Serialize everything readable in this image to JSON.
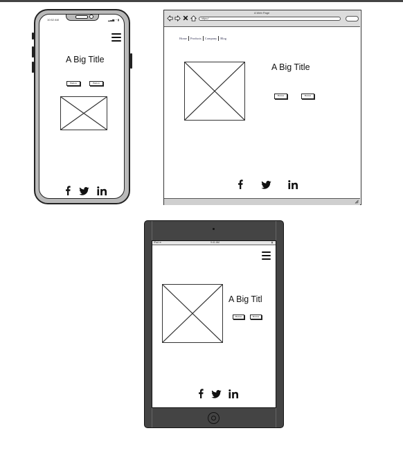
{
  "phone": {
    "status_time": "10:52 AM",
    "status_icons": "▂▃▅ ◔ ▮",
    "title": "A Big Title",
    "buttons": [
      "Button",
      "Button"
    ],
    "social": [
      "facebook-icon",
      "twitter-icon",
      "linkedin-icon"
    ]
  },
  "browser": {
    "window_title": "A Web Page",
    "url": "https://",
    "nav": [
      "Home",
      "Products",
      "Company",
      "Blog"
    ],
    "title": "A Big Title",
    "buttons": [
      "Button",
      "Button"
    ],
    "social": [
      "facebook-icon",
      "twitter-icon",
      "linkedin-icon"
    ]
  },
  "tablet": {
    "status_left": "iPad ≋",
    "status_time": "9:41 AM",
    "status_right": "▮",
    "title": "A Big Titl",
    "buttons": [
      "Button",
      "Button"
    ],
    "social": [
      "facebook-icon",
      "twitter-icon",
      "linkedin-icon"
    ]
  },
  "colors": {
    "device_frame": "#222222",
    "phone_bezel": "#b9b9b9",
    "tablet_body": "#444444",
    "browser_chrome": "#dcdcdc"
  }
}
